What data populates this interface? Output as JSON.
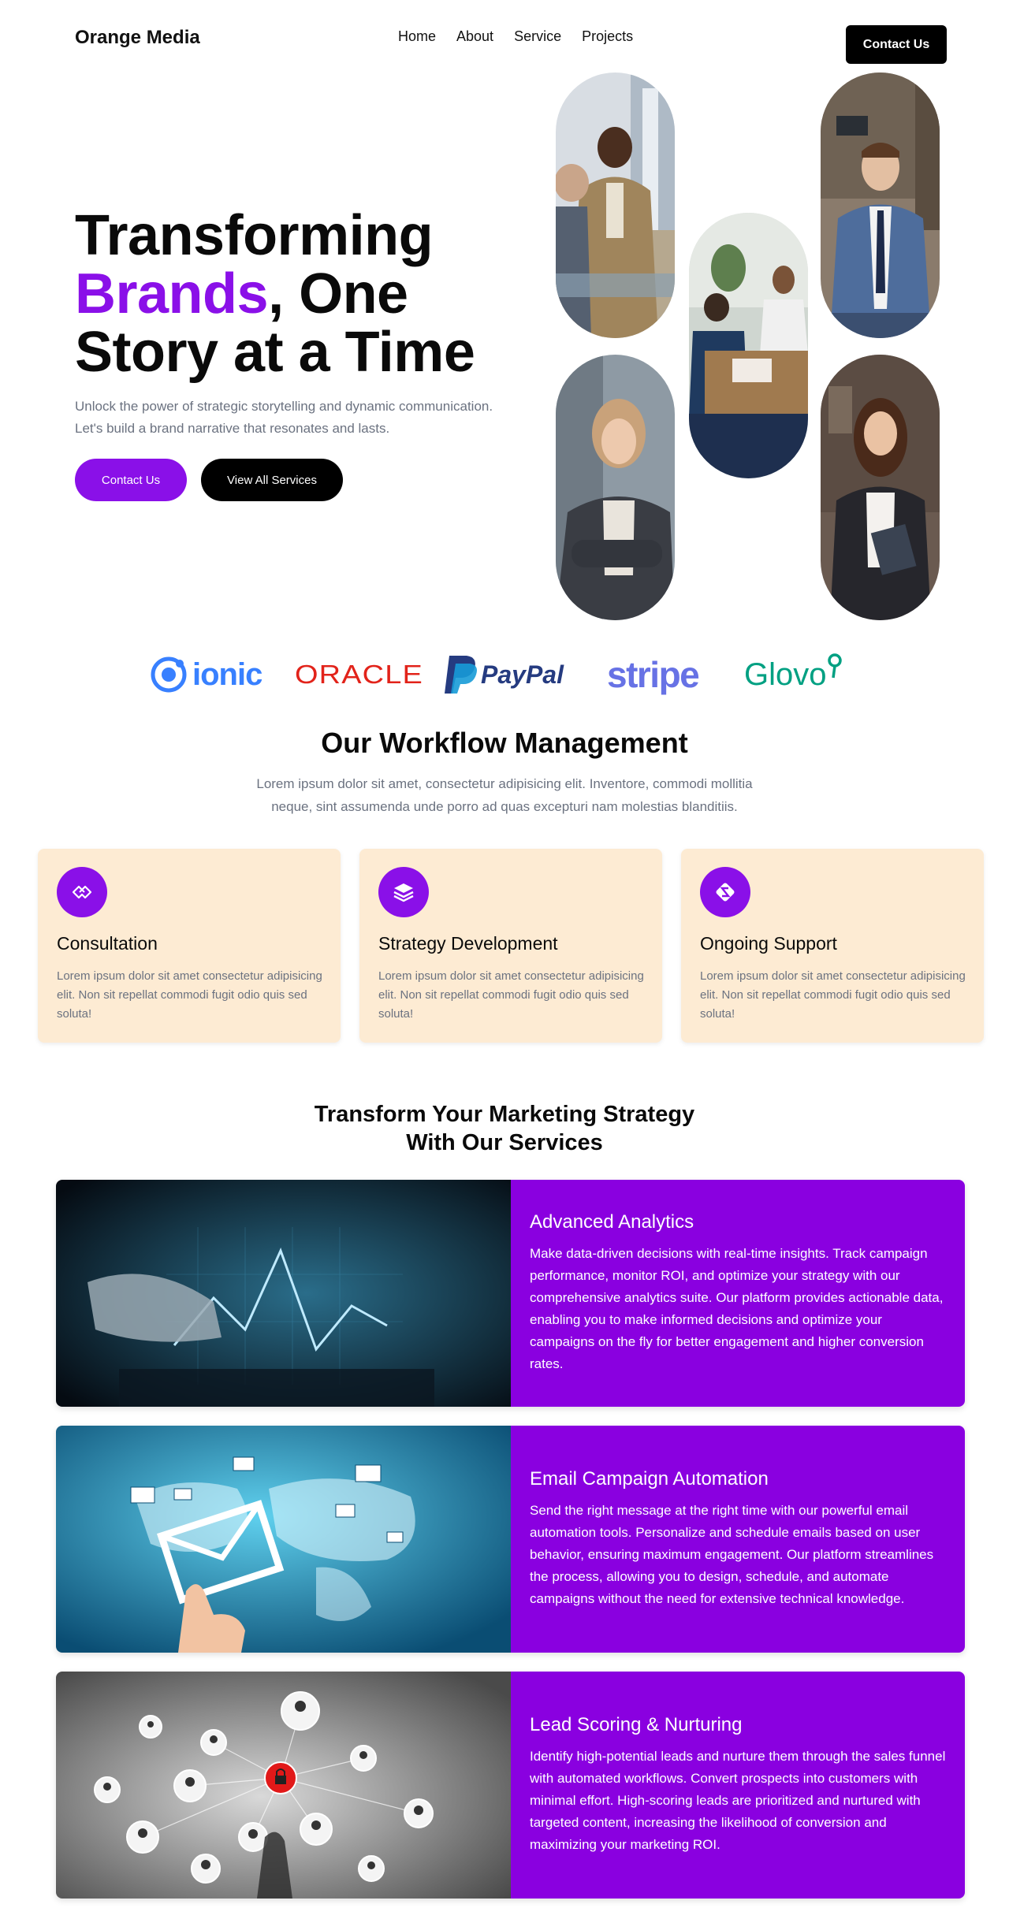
{
  "nav": {
    "brand": "Orange Media",
    "links": [
      "Home",
      "About",
      "Service",
      "Projects"
    ],
    "cta": "Contact Us"
  },
  "hero": {
    "title_line1": "Transforming",
    "title_accent": "Brands",
    "title_rest": ", One",
    "title_line3": "Story at a Time",
    "subtitle": "Unlock the power of strategic storytelling and dynamic communication. Let's build a brand narrative that resonates and lasts.",
    "primary_button": "Contact Us",
    "secondary_button": "View All Services"
  },
  "logos": [
    {
      "name": "ionic",
      "text": "ionic",
      "color": "#3880ff"
    },
    {
      "name": "oracle",
      "text": "ORACLE",
      "color": "#e2231a"
    },
    {
      "name": "paypal",
      "text": "PayPal",
      "color": "#253b80"
    },
    {
      "name": "stripe",
      "text": "stripe",
      "color": "#6772e5"
    },
    {
      "name": "glovo",
      "text": "Glovo",
      "color": "#00a082"
    }
  ],
  "workflow": {
    "title": "Our Workflow Management",
    "subtitle": "Lorem ipsum dolor sit amet, consectetur adipisicing elit. Inventore, commodi mollitia neque, sint assumenda unde porro ad quas excepturi nam molestias blanditiis.",
    "cards": [
      {
        "title": "Consultation",
        "text": "Lorem ipsum dolor sit amet consectetur adipisicing elit. Non sit repellat commodi fugit odio quis sed soluta!",
        "icon": "handshake-icon"
      },
      {
        "title": "Strategy Development",
        "text": "Lorem ipsum dolor sit amet consectetur adipisicing elit. Non sit repellat commodi fugit odio quis sed soluta!",
        "icon": "layers-icon"
      },
      {
        "title": "Ongoing Support",
        "text": "Lorem ipsum dolor sit amet consectetur adipisicing elit. Non sit repellat commodi fugit odio quis sed soluta!",
        "icon": "support-icon"
      }
    ]
  },
  "services": {
    "title_line1": "Transform Your Marketing Strategy",
    "title_line2": "With Our Services",
    "items": [
      {
        "title": "Advanced Analytics",
        "text": "Make data-driven decisions with real-time insights. Track campaign performance, monitor ROI, and optimize your strategy with our comprehensive analytics suite. Our platform provides actionable data, enabling you to make informed decisions and optimize your campaigns on the fly for better engagement and higher conversion rates."
      },
      {
        "title": "Email Campaign Automation",
        "text": "Send the right message at the right time with our powerful email automation tools. Personalize and schedule emails based on user behavior, ensuring maximum engagement. Our platform streamlines the process, allowing you to design, schedule, and automate campaigns without the need for extensive technical knowledge."
      },
      {
        "title": "Lead Scoring & Nurturing",
        "text": "Identify high-potential leads and nurture them through the sales funnel with automated workflows. Convert prospects into customers with minimal effort. High-scoring leads are prioritized and nurtured with targeted content, increasing the likelihood of conversion and maximizing your marketing ROI."
      }
    ]
  },
  "colors": {
    "accent": "#8a10e8",
    "card_bg": "#fdebd3",
    "service_bg": "#8a00e0"
  }
}
